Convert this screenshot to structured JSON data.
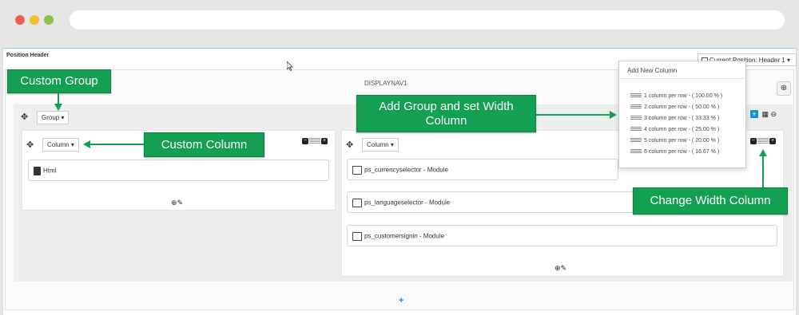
{
  "page": {
    "position_title": "Position Header",
    "current_position": "Current Position: Header 1",
    "hook_name": "DISPLAYNAV1"
  },
  "group": {
    "dropdown_label": "Group"
  },
  "columns": [
    {
      "dropdown_label": "Column",
      "modules": [
        {
          "name": "Html"
        }
      ]
    },
    {
      "dropdown_label": "Column",
      "modules": [
        {
          "name": "ps_currencyselector - Module"
        },
        {
          "name": "ps_languageselector - Module"
        },
        {
          "name": "ps_customersignin - Module"
        }
      ]
    }
  ],
  "popover": {
    "title": "Add New Column",
    "options": [
      "1 column per row - ( 100.00 % )",
      "2 column per row - ( 50.00 % )",
      "3 column per row - ( 33.33 % )",
      "4 column per row - ( 25.00 % )",
      "5 column per row - ( 20.00 % )",
      "6 column per row - ( 16.67 % )"
    ]
  },
  "callouts": {
    "custom_group": "Custom Group",
    "custom_column": "Custom Column",
    "add_group": "Add Group and set Width Column",
    "change_width": "Change Width Column"
  },
  "icons": {
    "move": "move-icon",
    "plus": "plus-icon",
    "edit": "pencil-icon",
    "caret": "caret-down-icon"
  },
  "colors": {
    "callout": "#14a053",
    "accent": "#1a8fd6"
  }
}
